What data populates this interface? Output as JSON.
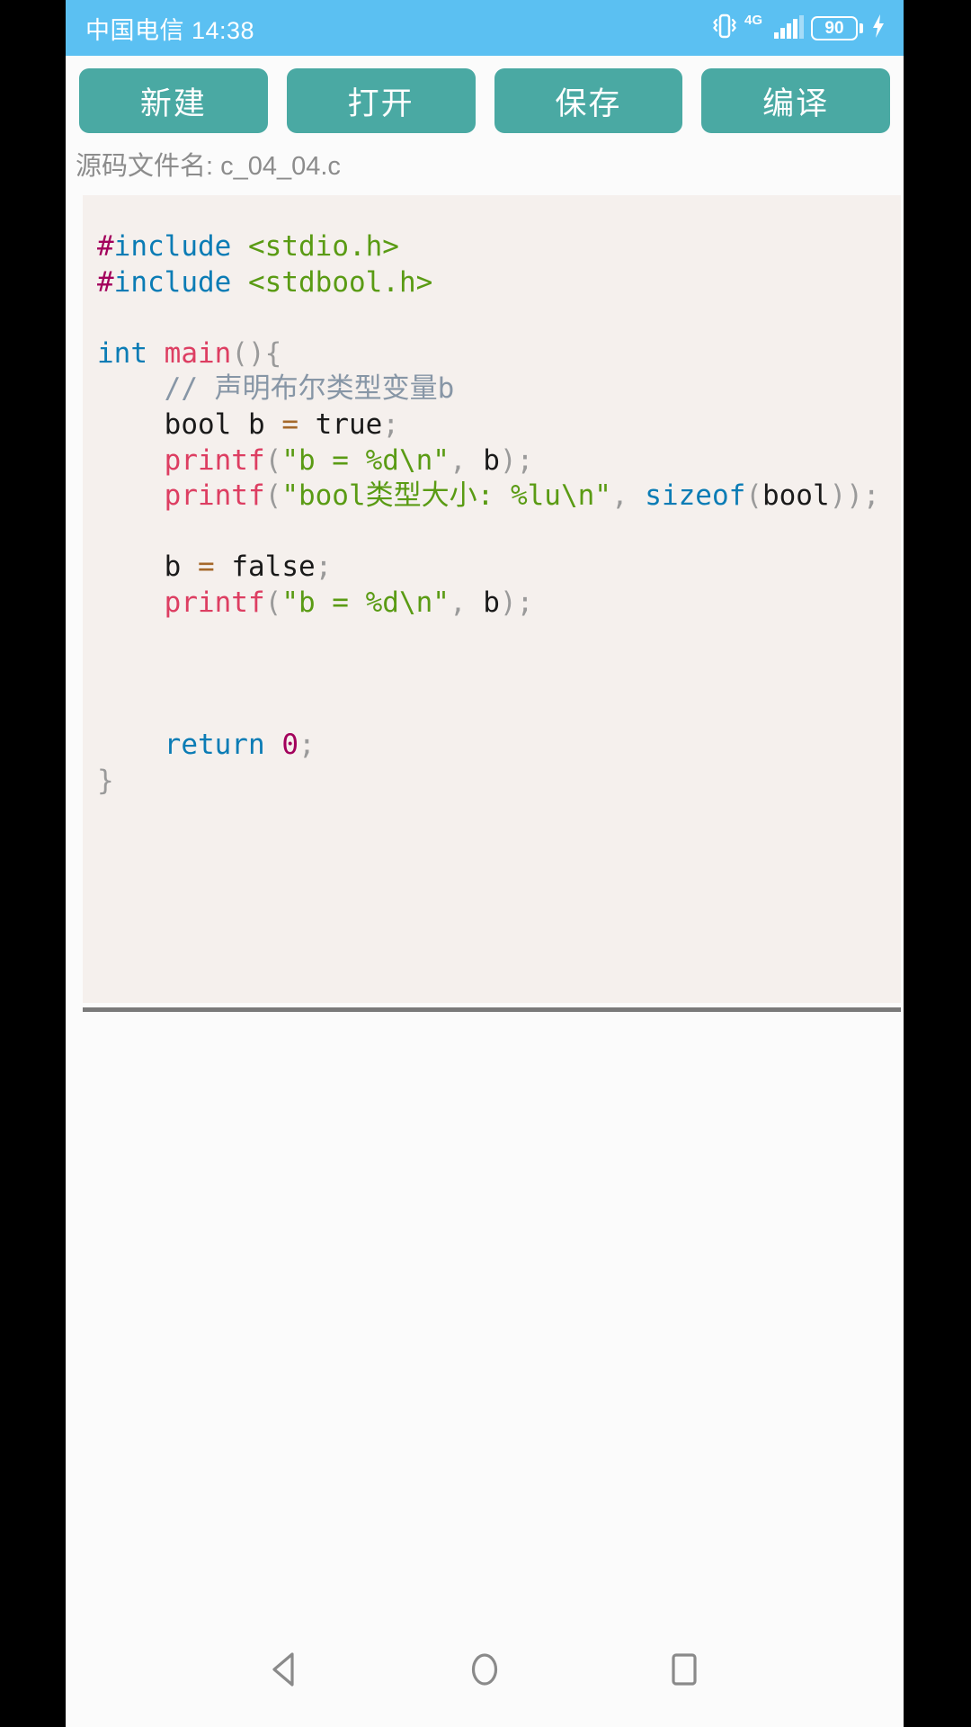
{
  "status_bar": {
    "carrier_time": "中国电信 14:38",
    "icons": [
      "vibrate-icon",
      "network-4g-icon",
      "signal-bars-icon",
      "battery-icon",
      "charging-bolt-icon"
    ],
    "network_label": "4G",
    "battery_level": "90",
    "background_color": "#5bc0f2"
  },
  "toolbar": {
    "accent_color": "#4aa9a3",
    "buttons": [
      {
        "name": "new-button",
        "label": "新建"
      },
      {
        "name": "open-button",
        "label": "打开"
      },
      {
        "name": "save-button",
        "label": "保存"
      },
      {
        "name": "compile-button",
        "label": "编译"
      }
    ]
  },
  "file_info": {
    "label": "源码文件名:",
    "filename": "c_04_04.c"
  },
  "editor": {
    "background_color": "#f5f0ed",
    "source_text": "#include <stdio.h>\n#include <stdbool.h>\n\nint main(){\n    // 声明布尔类型变量b\n    bool b = true;\n    printf(\"b = %d\\n\", b);\n    printf(\"bool类型大小: %lu\\n\", sizeof(bool));\n\n    b = false;\n    printf(\"b = %d\\n\", b);\n\n\n\n    return 0;\n}",
    "syntax_colors": {
      "preprocessor_hash": "#a3005c",
      "preprocessor_keyword": "#0b7cb5",
      "include_path": "#5a9b14",
      "keyword": "#0b7cb5",
      "function": "#dd3e62",
      "punctuation": "#9a9a9a",
      "comment": "#8796a6",
      "string": "#5a9b14",
      "operator": "#a5682a",
      "number": "#a3005c",
      "plain": "#1a1a1a"
    }
  },
  "output_pane": {
    "text": ""
  },
  "nav_bar": {
    "buttons": [
      {
        "name": "nav-back-button",
        "icon": "back-triangle-icon"
      },
      {
        "name": "nav-home-button",
        "icon": "home-circle-icon"
      },
      {
        "name": "nav-recents-button",
        "icon": "recents-square-icon"
      }
    ]
  }
}
